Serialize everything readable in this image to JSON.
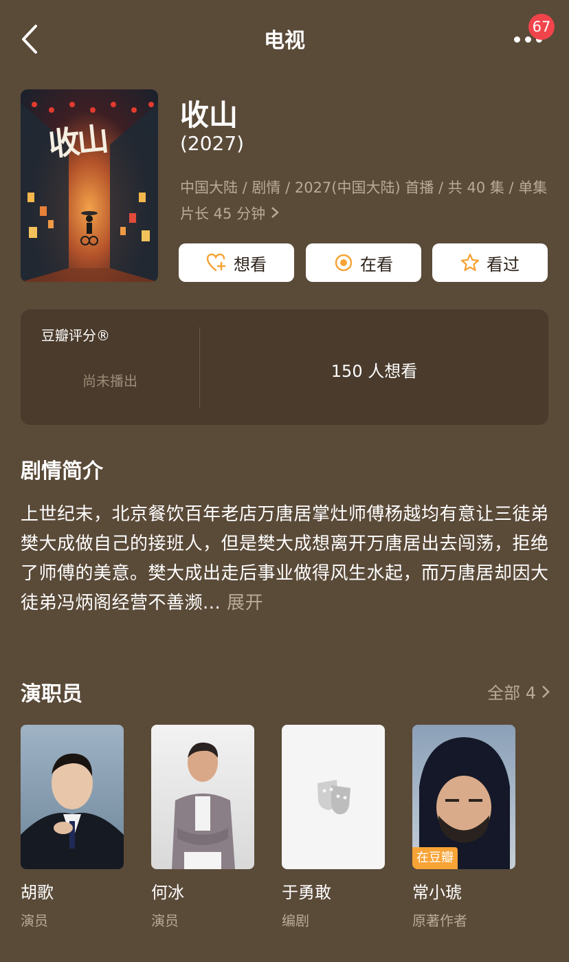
{
  "nav": {
    "title": "电视",
    "badge": "67"
  },
  "show": {
    "title": "收山",
    "year": "(2027)",
    "meta": "中国大陆 / 剧情 / 2027(中国大陆) 首播 / 共 40 集 / 单集片长 45 分钟",
    "poster_text": "收山"
  },
  "actions": {
    "want": "想看",
    "watching": "在看",
    "watched": "看过"
  },
  "rating": {
    "label": "豆瓣评分®",
    "status": "尚未播出",
    "wish_count": "150 人想看"
  },
  "synopsis": {
    "title": "剧情简介",
    "text": "上世纪末，北京餐饮百年老店万唐居掌灶师傅杨越均有意让三徒弟樊大成做自己的接班人，但是樊大成想离开万唐居出去闯荡，拒绝了师傅的美意。樊大成出走后事业做得风生水起，而万唐居却因大徒弟冯炳阁经营不善濒...",
    "expand": "展开"
  },
  "cast": {
    "title": "演职员",
    "all_label": "全部 4",
    "members": [
      {
        "name": "胡歌",
        "role": "演员"
      },
      {
        "name": "何冰",
        "role": "演员"
      },
      {
        "name": "于勇敢",
        "role": "编剧"
      },
      {
        "name": "常小琥",
        "role": "原著作者",
        "tag": "在豆瓣"
      }
    ]
  },
  "colors": {
    "background": "#5a4a38",
    "card": "#4a3b2c",
    "accent": "#f7a336",
    "badge": "#f0444b"
  },
  "icons": [
    "back-arrow-icon",
    "more-icon",
    "heart-plus-icon",
    "eye-circle-icon",
    "star-icon",
    "chevron-right-icon",
    "theater-mask-icon"
  ]
}
